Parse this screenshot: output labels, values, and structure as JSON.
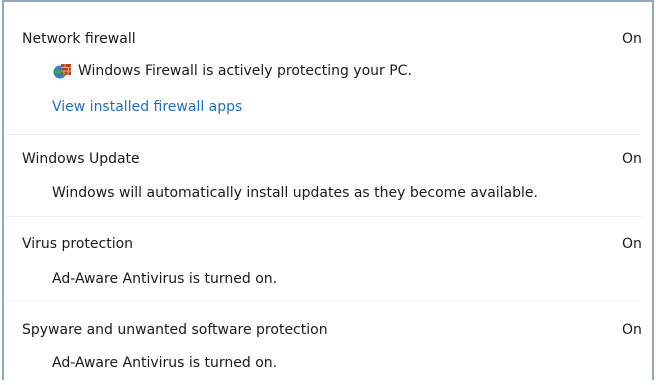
{
  "sections": [
    {
      "title": "Network firewall",
      "status": "On",
      "description": "Windows Firewall is actively protecting your PC.",
      "description_icon": "firewall-shield-icon",
      "link": "View installed firewall apps"
    },
    {
      "title": "Windows Update",
      "status": "On",
      "description": "Windows will automatically install updates as they become available."
    },
    {
      "title": "Virus protection",
      "status": "On",
      "description": "Ad-Aware Antivirus is turned on."
    },
    {
      "title": "Spyware and unwanted software protection",
      "status": "On",
      "description": "Ad-Aware Antivirus is turned on."
    }
  ],
  "colors": {
    "link": "#1f6fc5",
    "border": "#8ea7c2",
    "text": "#1a1a1a"
  }
}
